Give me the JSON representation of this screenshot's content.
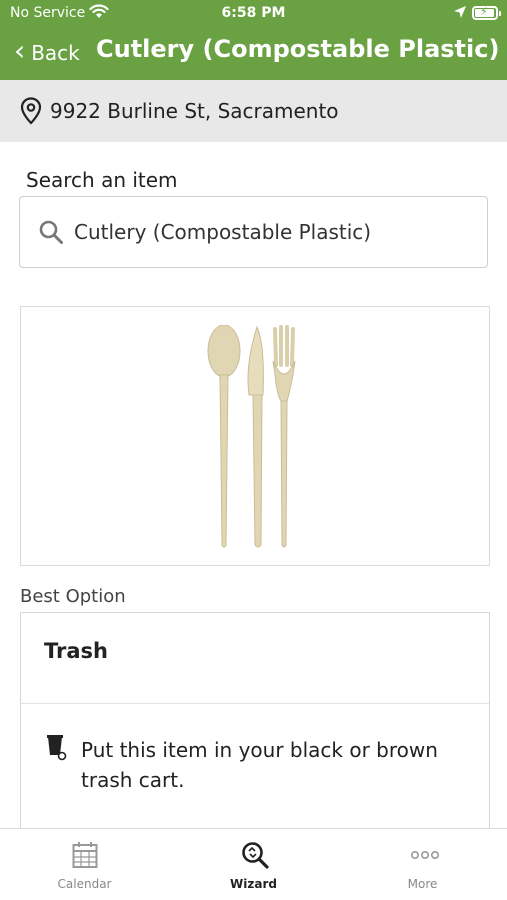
{
  "status_bar": {
    "carrier": "No Service",
    "time": "6:58 PM"
  },
  "nav": {
    "back_label": "Back",
    "title": "Cutlery (Compostable Plastic)"
  },
  "address": "9922 Burline St, Sacramento",
  "search": {
    "label": "Search an item",
    "value": "Cutlery (Compostable Plastic)"
  },
  "best_option": {
    "section_label": "Best Option",
    "title": "Trash",
    "description": "Put this item in your black or brown trash cart."
  },
  "tabs": [
    {
      "label": "Calendar",
      "icon": "calendar-icon",
      "active": false
    },
    {
      "label": "Wizard",
      "icon": "wizard-search-icon",
      "active": true
    },
    {
      "label": "More",
      "icon": "more-dots-icon",
      "active": false
    }
  ],
  "colors": {
    "header": "#6aa142",
    "address_bar": "#e8e8e8"
  }
}
